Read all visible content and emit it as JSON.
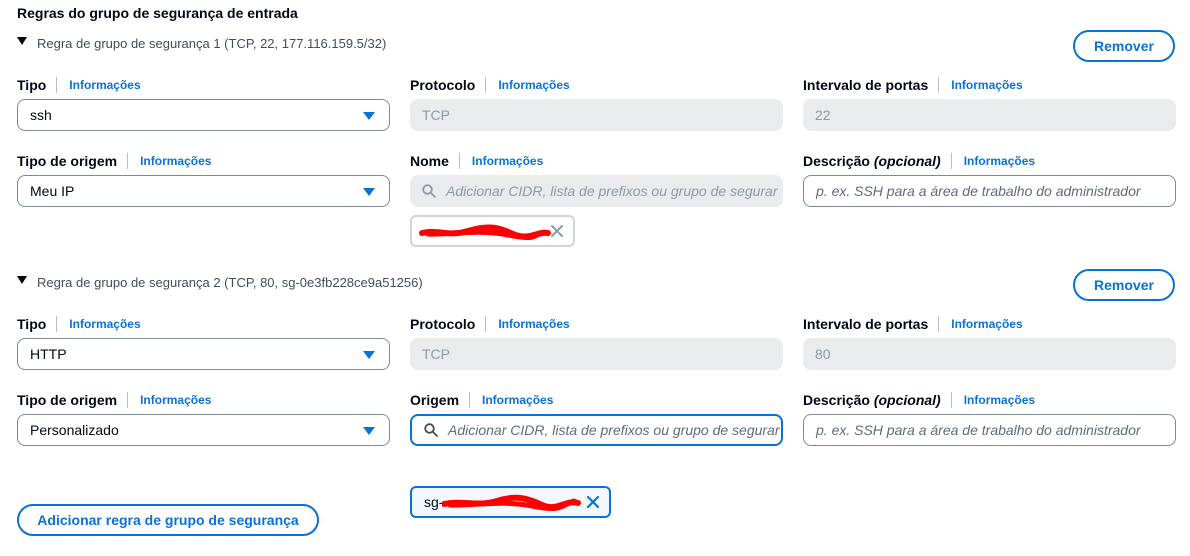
{
  "section": {
    "title": "Regras do grupo de segurança de entrada"
  },
  "rule1": {
    "header": "Regra de grupo de segurança 1 (TCP, 22, 177.116.159.5/32)",
    "remove_label": "Remover",
    "type_label": "Tipo",
    "type_value": "ssh",
    "protocol_label": "Protocolo",
    "protocol_value": "TCP",
    "port_label": "Intervalo de portas",
    "port_value": "22",
    "source_type_label": "Tipo de origem",
    "source_type_value": "Meu IP",
    "name_label": "Nome",
    "name_placeholder": "Adicionar CIDR, lista de prefixos ou grupo de segurar",
    "desc_label": "Descrição",
    "desc_optional": "(opcional)",
    "desc_placeholder": "p. ex. SSH para a área de trabalho do administrador"
  },
  "rule2": {
    "header": "Regra de grupo de segurança 2 (TCP, 80, sg-0e3fb228ce9a51256)",
    "remove_label": "Remover",
    "type_label": "Tipo",
    "type_value": "HTTP",
    "protocol_label": "Protocolo",
    "protocol_value": "TCP",
    "port_label": "Intervalo de portas",
    "port_value": "80",
    "source_type_label": "Tipo de origem",
    "source_type_value": "Personalizado",
    "origin_label": "Origem",
    "origin_placeholder": "Adicionar CIDR, lista de prefixos ou grupo de segurar",
    "token_prefix": "sg-",
    "desc_label": "Descrição",
    "desc_optional": "(opcional)",
    "desc_placeholder": "p. ex. SSH para a área de trabalho do administrador"
  },
  "info_label": "Informações",
  "add_rule_label": "Adicionar regra de grupo de segurança",
  "colors": {
    "accent": "#0972d3",
    "redaction": "#ff0000"
  },
  "icons": {
    "caret": "caret-down-icon",
    "dropdown": "dropdown-arrow-icon",
    "search": "search-icon",
    "remove_token": "close-icon"
  }
}
